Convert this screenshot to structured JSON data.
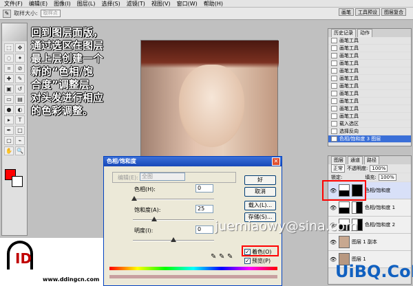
{
  "menu": [
    "文件(F)",
    "编辑(E)",
    "图像(I)",
    "图层(L)",
    "选择(S)",
    "滤镜(T)",
    "视图(V)",
    "窗口(W)",
    "帮助(H)"
  ],
  "options": {
    "sample_label": "取样大小:",
    "sample_value": "取样点"
  },
  "top_tabs": [
    "画笔",
    "工具预设",
    "图层复合"
  ],
  "instruction": [
    "回到图层面版，",
    "通过选区在图层",
    "最上层创建一个",
    "新的“色相/饱",
    "合度”调整层，",
    "对头发进行相应",
    "的色彩调整。"
  ],
  "dialog": {
    "title": "色相/饱和度",
    "edit_label": "编辑(E):",
    "edit_value": "全图",
    "hue_label": "色相(H):",
    "hue_value": "0",
    "sat_label": "饱和度(A):",
    "sat_value": "25",
    "light_label": "明度(I):",
    "light_value": "0",
    "ok": "好",
    "cancel": "取消",
    "load": "载入(L)...",
    "save": "存储(S)...",
    "colorize": "着色(O)",
    "preview": "预览(P)"
  },
  "history": {
    "tabs": [
      "历史记录",
      "动作"
    ],
    "items": [
      "画笔工具",
      "画笔工具",
      "画笔工具",
      "画笔工具",
      "画笔工具",
      "画笔工具",
      "画笔工具",
      "画笔工具",
      "画笔工具",
      "画笔工具",
      "画笔工具",
      "载入选区",
      "选择反向",
      "色相/饱和度 3 图层"
    ]
  },
  "layers": {
    "tabs": [
      "图层",
      "通道",
      "路径"
    ],
    "blend": "正常",
    "opacity_label": "不透明度:",
    "opacity": "100%",
    "lock_label": "锁定:",
    "fill_label": "填充:",
    "fill": "100%",
    "items": [
      {
        "name": "色相/饱和度",
        "eye": "👁"
      },
      {
        "name": "色相/饱和度 1",
        "eye": "👁"
      },
      {
        "name": "色相/饱和度 2",
        "eye": "👁"
      },
      {
        "name": "图层 1 副本",
        "eye": "👁"
      },
      {
        "name": "图层 1",
        "eye": "👁"
      }
    ]
  },
  "watermark": "juemiaowy@sina.com",
  "logo_url": "www.ddingcn.com",
  "brand": "UiBQ.CoM"
}
